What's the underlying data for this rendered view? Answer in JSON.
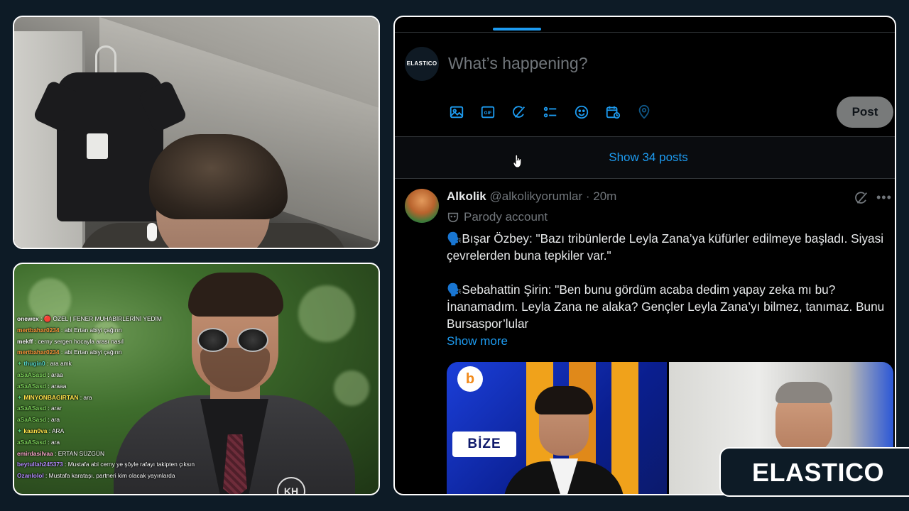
{
  "twitter": {
    "compose_avatar_text": "ELASTICO",
    "compose_placeholder": "What’s happening?",
    "toolbar_icons": [
      "image-icon",
      "gif-icon",
      "grok-icon",
      "poll-icon",
      "emoji-icon",
      "schedule-icon",
      "location-icon"
    ],
    "post_label": "Post",
    "show_posts_label": "Show 34 posts",
    "tweet": {
      "name": "Alkolik",
      "handle": "@alkolikyorumlar",
      "separator": "·",
      "time": "20m",
      "parody_label": "Parody account",
      "paragraph1": "🗣️Bışar Özbey: \"Bazı tribünlerde  Leyla Zana’ya küfürler edilmeye başladı. Siyasi çevrelerden buna tepkiler var.\"",
      "paragraph2": "🗣️Sebahattin Şirin: \"Ben bunu gördüm acaba dedim yapay zeka mı bu? İnanamadım. Leyla Zana ne alaka? Gençler Leyla Zana’yı bilmez, tanımaz. Bunu Bursaspor’lular",
      "show_more": "Show more",
      "media_badge": "BİZE",
      "media_circle_letter": "b"
    },
    "accent_color": "#1d9bf0"
  },
  "chat": {
    "messages": [
      {
        "user": "onewex",
        "text": ": 🔴 ÖZEL | FENER MUHABİRLERİNİ YEDİM",
        "color": "#ffffff",
        "badge": ""
      },
      {
        "user": "mertbahar0234",
        "text": ": abi Ertan abiyi çağırın",
        "color": "#ff9a3c",
        "badge": ""
      },
      {
        "user": "mekff",
        "text": ": cerny sergen hocayla arası nasıl",
        "color": "#ffffff",
        "badge": ""
      },
      {
        "user": "mertbahar0234",
        "text": ": abi Ertan abiyi çağırın",
        "color": "#ff9a3c",
        "badge": ""
      },
      {
        "user": "thugin0",
        "text": ": ara amk",
        "color": "#56d6c8",
        "badge": "✦"
      },
      {
        "user": "aSaASasd",
        "text": ": araa",
        "color": "#7dd35a",
        "badge": ""
      },
      {
        "user": "aSaASasd",
        "text": ": araaa",
        "color": "#7dd35a",
        "badge": ""
      },
      {
        "user": "MINYONBAGIRTAN",
        "text": ": ara",
        "color": "#ffe24a",
        "badge": "✦"
      },
      {
        "user": "aSaASasd",
        "text": ": arar",
        "color": "#7dd35a",
        "badge": ""
      },
      {
        "user": "aSaASasd",
        "text": ": ara",
        "color": "#7dd35a",
        "badge": ""
      },
      {
        "user": "kaan0va",
        "text": ": ARA",
        "color": "#ffe24a",
        "badge": "✦"
      },
      {
        "user": "aSaASasd",
        "text": ": ara",
        "color": "#7dd35a",
        "badge": ""
      },
      {
        "user": "emirdasilvaa",
        "text": ": ERTAN SÜZGÜN",
        "color": "#f7a6c9",
        "badge": ""
      },
      {
        "user": "beytullah245373",
        "text": ": Mustafa abi cerny ye şöyle rafayı takipten çıksın",
        "color": "#b58cff",
        "badge": ""
      },
      {
        "user": "Ozanlolol",
        "text": ": Mustafa karataşı. partneri kim olacak yayınlarda",
        "color": "#b58cff",
        "badge": ""
      }
    ]
  },
  "brand": {
    "logo_text": "ELASTICO",
    "bg_color": "#0d1b26"
  }
}
